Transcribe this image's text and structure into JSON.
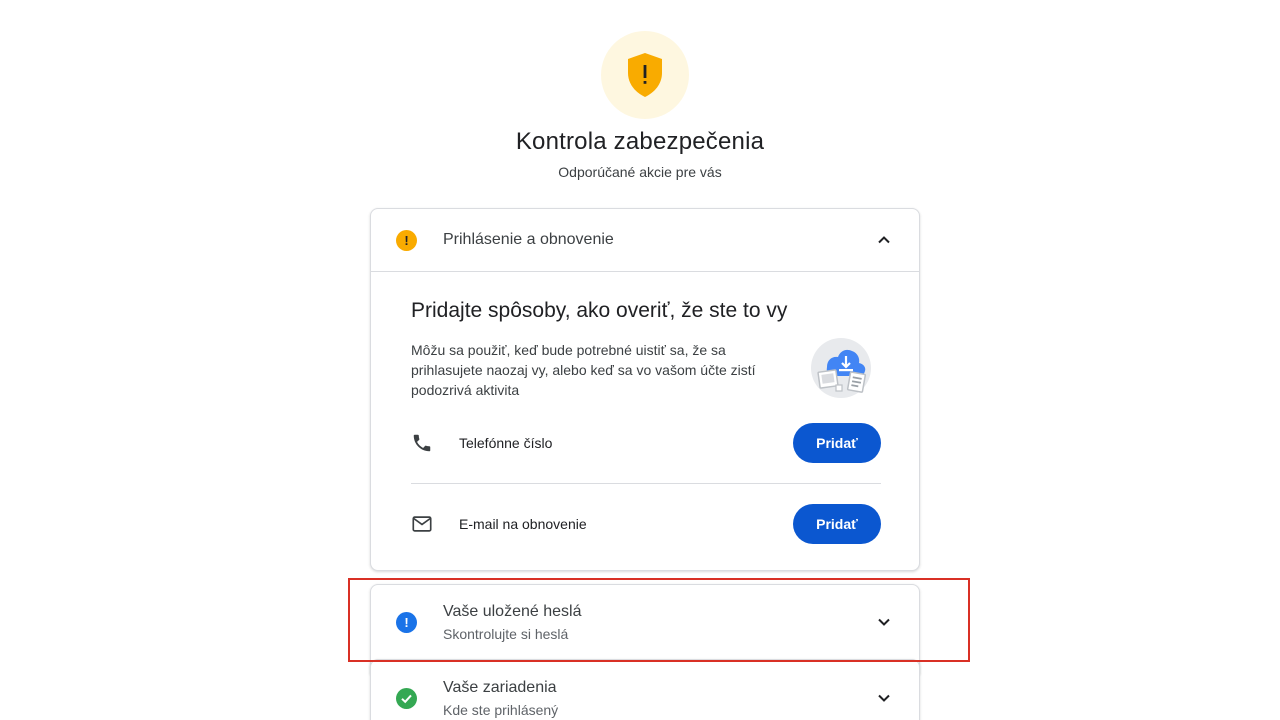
{
  "header": {
    "title": "Kontrola zabezpečenia",
    "subtitle": "Odporúčané akcie pre vás",
    "badge_icon": "shield-warning-icon",
    "badge_color": "#f9ab00"
  },
  "sections": [
    {
      "title": "Prihlásenie a obnovenie",
      "status": "warning",
      "status_symbol": "!",
      "expanded": true,
      "content": {
        "heading": "Pridajte spôsoby, ako overiť, že ste to vy",
        "description": "Môžu sa použiť, keď bude potrebné uistiť sa, že sa prihlasujete naozaj vy, alebo keď sa vo vašom účte zistí podozrivá aktivita",
        "methods": [
          {
            "label": "Telefónne číslo",
            "icon": "phone-icon",
            "button": "Pridať"
          },
          {
            "label": "E-mail na obnovenie",
            "icon": "mail-icon",
            "button": "Pridať"
          }
        ]
      }
    },
    {
      "title": "Vaše uložené heslá",
      "subtitle": "Skontrolujte si heslá",
      "status": "info",
      "status_symbol": "!",
      "expanded": false,
      "highlighted": true
    },
    {
      "title": "Vaše zariadenia",
      "subtitle": "Kde ste prihlásený",
      "status": "ok",
      "expanded": false
    }
  ],
  "colors": {
    "primary_button": "#0b57d0",
    "warning": "#f9ab00",
    "info": "#1a73e8",
    "ok": "#34a853",
    "highlight": "#d93025"
  }
}
